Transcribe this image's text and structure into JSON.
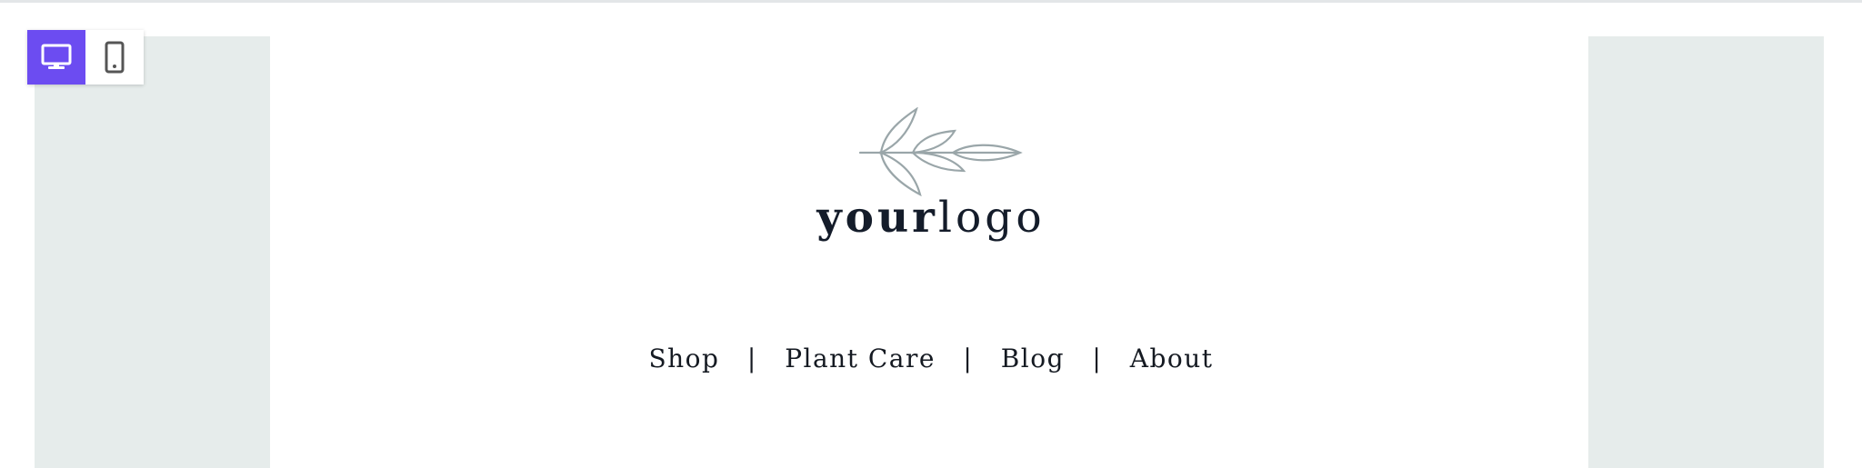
{
  "view_toggle": {
    "desktop_icon": "desktop-monitor-icon",
    "mobile_icon": "mobile-phone-icon",
    "active": "desktop",
    "accent_color": "#6c4cf1"
  },
  "logo": {
    "icon": "leaf-branch-icon",
    "text_bold": "your",
    "text_light": "logo"
  },
  "nav": {
    "items": [
      {
        "label": "Shop"
      },
      {
        "label": "Plant Care"
      },
      {
        "label": "Blog"
      },
      {
        "label": "About"
      }
    ],
    "separator": "|"
  },
  "colors": {
    "side_panels": "#e6eceb",
    "logo_text": "#141c2a",
    "leaf_stroke": "#9aa6a9"
  }
}
